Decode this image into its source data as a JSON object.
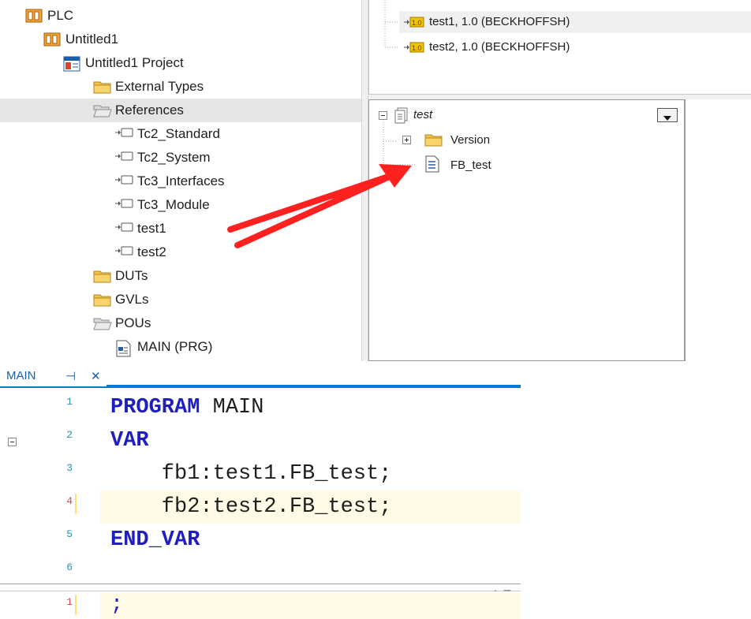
{
  "solution_tree": {
    "items": [
      {
        "label": "PLC",
        "icon": "plc-icon",
        "expander": "expanded"
      },
      {
        "label": "Untitled1",
        "icon": "plc-project-icon",
        "expander": "expanded"
      },
      {
        "label": "Untitled1 Project",
        "icon": "project-icon",
        "expander": "expanded"
      },
      {
        "label": "External Types",
        "icon": "folder-icon",
        "expander": "collapsed"
      },
      {
        "label": "References",
        "icon": "folder-open-icon",
        "expander": "expanded",
        "selected": true
      },
      {
        "label": "Tc2_Standard",
        "icon": "library-reference-icon"
      },
      {
        "label": "Tc2_System",
        "icon": "library-reference-icon"
      },
      {
        "label": "Tc3_Interfaces",
        "icon": "library-reference-icon"
      },
      {
        "label": "Tc3_Module",
        "icon": "library-reference-icon"
      },
      {
        "label": "test1",
        "icon": "library-reference-icon"
      },
      {
        "label": "test2",
        "icon": "library-reference-icon"
      },
      {
        "label": "DUTs",
        "icon": "folder-icon"
      },
      {
        "label": "GVLs",
        "icon": "folder-icon"
      },
      {
        "label": "POUs",
        "icon": "folder-open-icon",
        "expander": "expanded"
      },
      {
        "label": "MAIN (PRG)",
        "icon": "pou-icon"
      }
    ]
  },
  "library_manager": {
    "references": [
      {
        "label": "test1, 1.0 (BECKHOFFSH)",
        "icon": "library-version-icon",
        "selected": true
      },
      {
        "label": "test2, 1.0 (BECKHOFFSH)",
        "icon": "library-version-icon"
      }
    ],
    "content_tree": {
      "root": {
        "label": "test",
        "icon": "library-root-icon"
      },
      "children": [
        {
          "label": "Version",
          "icon": "folder-icon"
        },
        {
          "label": "FB_test",
          "icon": "function-block-icon"
        }
      ]
    }
  },
  "editor": {
    "tab": {
      "title": "MAIN",
      "pin_glyph": "⊣",
      "close_glyph": "✕"
    },
    "declaration_lines": [
      {
        "num": "1",
        "tokens": [
          {
            "t": "PROGRAM",
            "kw": true
          },
          {
            "t": " MAIN",
            "kw": false
          }
        ]
      },
      {
        "num": "2",
        "tokens": [
          {
            "t": "VAR",
            "kw": true
          }
        ]
      },
      {
        "num": "3",
        "tokens": [
          {
            "t": "    fb1:test1.FB_test;",
            "kw": false
          }
        ]
      },
      {
        "num": "4",
        "tokens": [
          {
            "t": "    fb2:test2.FB_test;",
            "kw": false
          }
        ],
        "changed": true,
        "current": true
      },
      {
        "num": "5",
        "tokens": [
          {
            "t": "END_VAR",
            "kw": true
          }
        ]
      },
      {
        "num": "6",
        "tokens": []
      }
    ],
    "implementation_lines": [
      {
        "num": "1",
        "text": ";",
        "changed": true
      }
    ]
  },
  "colors": {
    "keyword": "#1f1fbf",
    "accent": "#007acc",
    "annotation_arrow": "#ff2020",
    "selection": "#e5e5e5"
  }
}
